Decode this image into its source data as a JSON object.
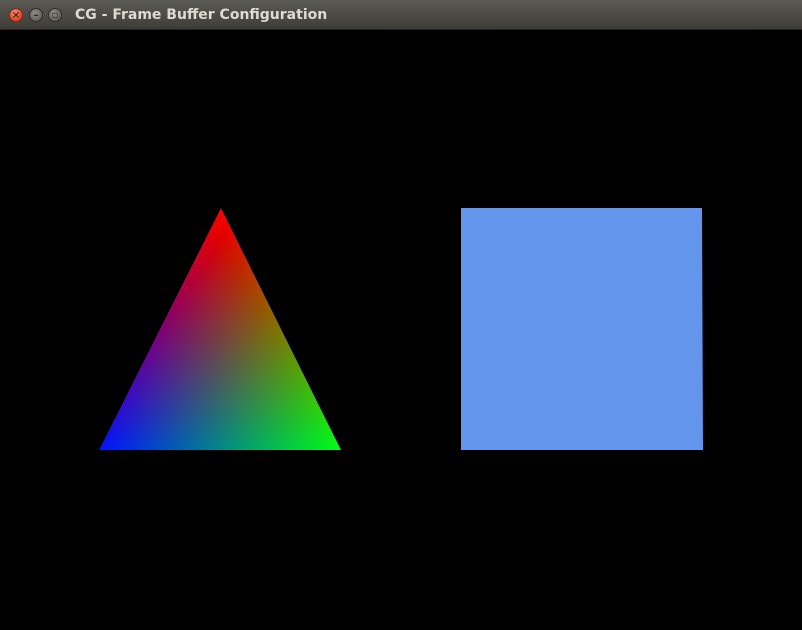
{
  "window": {
    "title": "CG - Frame Buffer Configuration",
    "controls": {
      "close_icon": "close-icon",
      "minimize_icon": "minimize-icon",
      "maximize_icon": "maximize-icon"
    }
  },
  "scene": {
    "background_color": "#000000",
    "triangle": {
      "vertex_colors": {
        "top": "#ff0000",
        "bottom_left": "#0000ff",
        "bottom_right": "#00ff00"
      }
    },
    "square": {
      "fill_color": "#6495ed"
    }
  }
}
